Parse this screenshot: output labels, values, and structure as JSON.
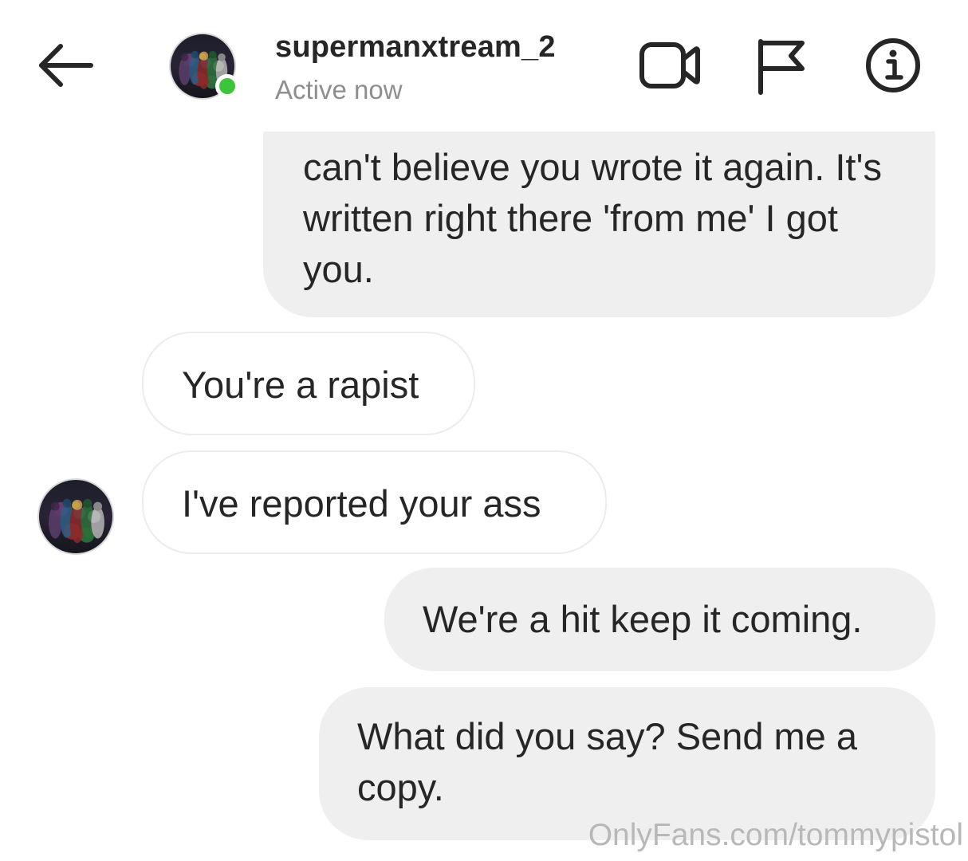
{
  "header": {
    "username": "supermanxtream_2",
    "status": "Active now",
    "online_color": "#3cc43a",
    "icons": [
      "back-arrow-icon",
      "video-call-icon",
      "flag-icon",
      "info-icon"
    ]
  },
  "messages": [
    {
      "sender": "me",
      "text": "can't believe you wrote it again. It's written right there 'from me' I got you."
    },
    {
      "sender": "them",
      "text": "You're a rapist"
    },
    {
      "sender": "them",
      "text": "I've reported your ass"
    },
    {
      "sender": "me",
      "text": "We're a hit keep it coming."
    },
    {
      "sender": "me",
      "text": "What did you say? Send me a copy."
    }
  ],
  "watermark": "OnlyFans.com/tommypistol",
  "colors": {
    "sent_bubble": "#efefef",
    "received_bubble_border": "#ececec",
    "text": "#262626",
    "muted": "#8e8e8e"
  }
}
